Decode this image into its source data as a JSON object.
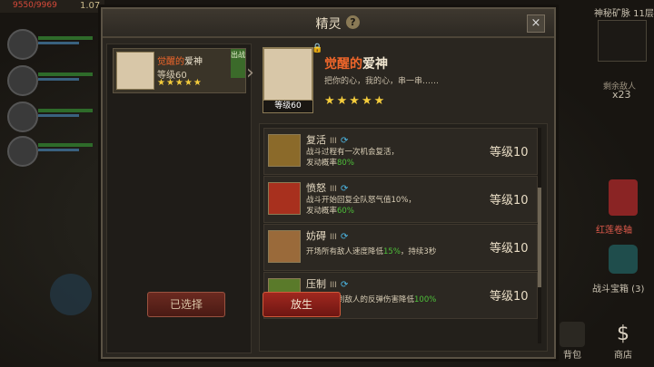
{
  "hud": {
    "top_left_red": "9550/9969",
    "top_left_number": "1.07",
    "right_level": "神秘矿脉 11层",
    "remaining_label": "剩余敌人",
    "remaining_count": "x23",
    "red_scroll_label": "红莲卷轴",
    "chest_label": "战斗宝箱 (3)",
    "bag_label": "背包",
    "shop_label": "商店",
    "shop_icon": "$"
  },
  "modal": {
    "title": "精灵",
    "help": "?",
    "close": "×"
  },
  "list": {
    "items": [
      {
        "name_prefix": "觉醒的",
        "name_main": "爱神",
        "level": "等级60",
        "stars": "★★★★★",
        "equipped_tag": "出战"
      }
    ]
  },
  "detail": {
    "name_prefix": "觉醒的",
    "name_main": "爱神",
    "desc": "把你的心，我的心，串一串……",
    "level_tag": "等级60",
    "stars": "★★★★★"
  },
  "skills": [
    {
      "name": "复活",
      "rank": "III",
      "desc_line1": "战斗过程有一次机会复活，",
      "desc_line2_prefix": "发动概率",
      "desc_line2_value": "80%",
      "level": "等级10",
      "icon": "resurrect-icon"
    },
    {
      "name": "愤怒",
      "rank": "III",
      "desc_line1": "战斗开始回复全队怒气值10%，",
      "desc_line2_prefix": "发动概率",
      "desc_line2_value": "60%",
      "level": "等级10",
      "icon": "rage-icon"
    },
    {
      "name": "妨碍",
      "rank": "III",
      "desc_line1_prefix": "开场所有敌人速度降低",
      "desc_line1_value": "15%",
      "desc_line1_suffix": "，持续3秒",
      "level": "等级10",
      "icon": "hinder-icon"
    },
    {
      "name": "压制",
      "rank": "III",
      "desc_line1_prefix": "持盾者受到敌人的反弹伤害降低",
      "desc_line1_value": "100%",
      "level": "等级10",
      "icon": "suppress-icon"
    }
  ],
  "buttons": {
    "selected": "已选择",
    "release": "放生"
  }
}
